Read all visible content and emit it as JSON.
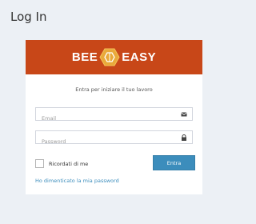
{
  "page": {
    "title": "Log In"
  },
  "brand": {
    "left_text": "BEE",
    "right_text": "EASY",
    "logo_icon": "bee-hexagon-icon",
    "bar_color": "#c84718"
  },
  "login": {
    "intro": "Entra per iniziare il tuo lavoro",
    "email_placeholder": "Email",
    "email_icon": "envelope-icon",
    "password_placeholder": "Password",
    "password_icon": "lock-icon",
    "remember_label": "Ricordati di me",
    "remember_checked": false,
    "submit_label": "Entra",
    "forgot_label": "Ho dimenticato la mia password"
  },
  "colors": {
    "background": "#ecf0f5",
    "primary": "#3c8dbc"
  }
}
